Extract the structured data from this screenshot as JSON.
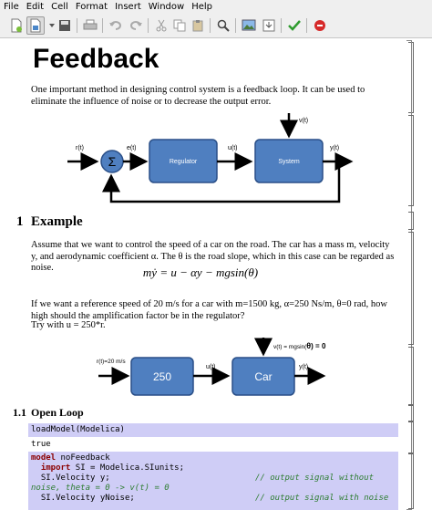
{
  "menu": [
    "File",
    "Edit",
    "Cell",
    "Format",
    "Insert",
    "Window",
    "Help"
  ],
  "toolbar": {
    "icons": [
      "new-document-icon",
      "open-file-icon",
      "save-icon",
      "print-icon",
      "undo-icon",
      "redo-icon",
      "cut-icon",
      "copy-icon",
      "paste-icon",
      "search-icon",
      "image-icon",
      "export-icon",
      "check-icon",
      "stop-icon"
    ]
  },
  "doc": {
    "title": "Feedback",
    "intro": "One important method in designing control system is a feedback loop. It can be used to eliminate the influence of noise or to decrease the output error.",
    "diagram1": {
      "r": "r(t)",
      "e": "e(t)",
      "u": "u(t)",
      "y": "y(t)",
      "v": "v(t)",
      "sum": "Σ",
      "regulator": "Regulator",
      "system": "System"
    },
    "section1": {
      "num": "1",
      "title": "Example"
    },
    "para2": "Assume that we want to control the speed of a car on the road. The car has a mass m, velocity y, and aerodynamic coefficient α. The θ is the road slope, which in this case can be regarded as noise.",
    "equation": "mẏ = u − αy − mgsin(θ)",
    "para3": "If we want a reference speed of 20 m/s for a car with m=1500 kg, α=250 Ns/m, θ=0 rad, how high should the amplification factor be in the regulator?",
    "para3b": "Try with u = 250*r.",
    "diagram2": {
      "r": "r(t)=20 m/s",
      "u": "u(t)",
      "y": "y(t)",
      "v_prefix": "v(t) = mgsin(",
      "v_theta": "θ",
      "v_suffix": ") = 0",
      "gain": "250",
      "car": "Car"
    },
    "section11": {
      "num": "1.1",
      "title": "Open Loop"
    },
    "cell1": "loadModel(Modelica)",
    "cell1_out": "true",
    "code": {
      "l1_kw": "model",
      "l1": " noFeedback",
      "l2_kw": "  import",
      "l2": " SI = Modelica.SIunits;",
      "l3": "  SI.Velocity y;",
      "l3_cm": "// output signal without",
      "l4_cm": "noise, theta = 0 -> v(t) = 0",
      "l5": "  SI.Velocity yNoise;",
      "l5_cm": "// output signal with noise"
    }
  }
}
